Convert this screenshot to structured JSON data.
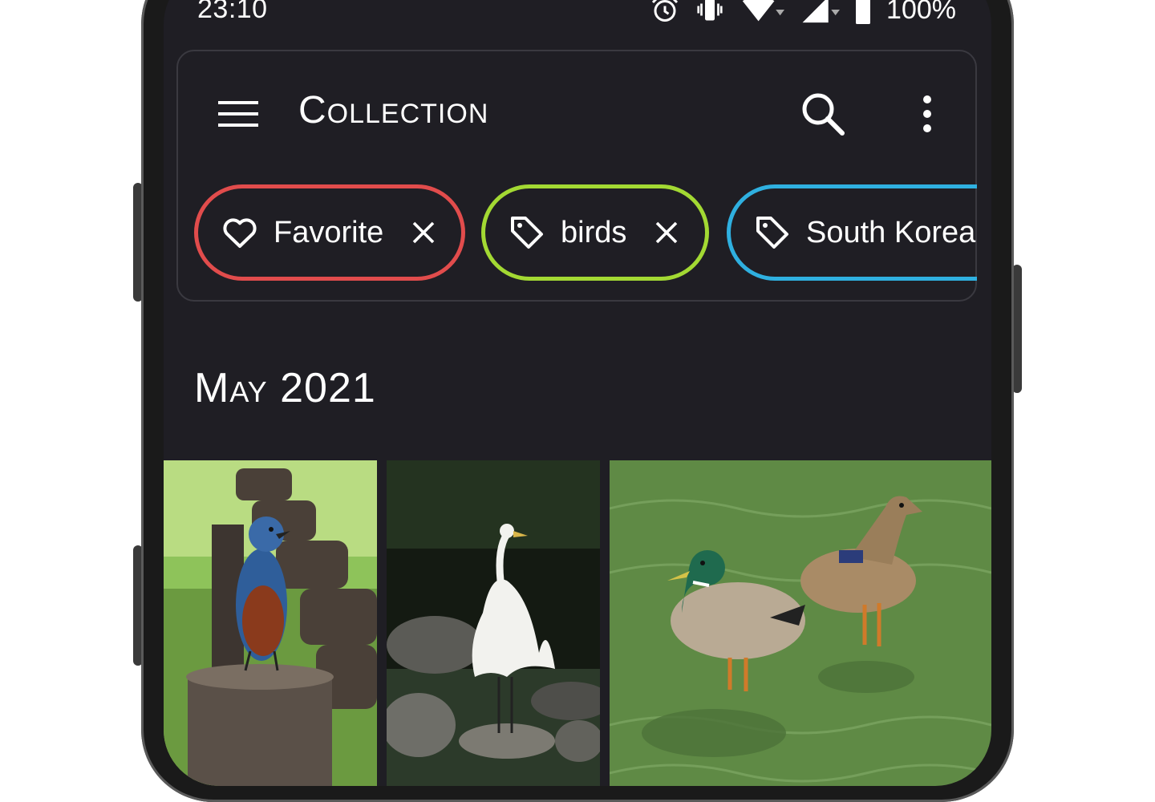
{
  "status_bar": {
    "time": "23:10",
    "battery": "100%",
    "icons": [
      "alarm-icon",
      "vibrate-icon",
      "wifi-icon",
      "signal-icon",
      "battery-icon"
    ]
  },
  "top_bar": {
    "title": "Collection",
    "icons": [
      "menu-icon",
      "search-icon",
      "more-vert-icon"
    ]
  },
  "filter_chips": [
    {
      "label": "Favorite",
      "icon": "heart-icon",
      "color": "#e14c4c",
      "removable": true
    },
    {
      "label": "birds",
      "icon": "tag-icon",
      "color": "#a3d933",
      "removable": true
    },
    {
      "label": "South Korea",
      "icon": "tag-icon",
      "color": "#2fb0e0",
      "removable": true
    }
  ],
  "section": {
    "title": "May 2021"
  },
  "thumbnails": [
    {
      "subject": "blue-rock-thrush-on-fence-post"
    },
    {
      "subject": "white-egret-on-rock"
    },
    {
      "subject": "mallard-ducks-in-water"
    }
  ],
  "colors": {
    "background": "#1f1e24",
    "text": "#ffffff"
  }
}
